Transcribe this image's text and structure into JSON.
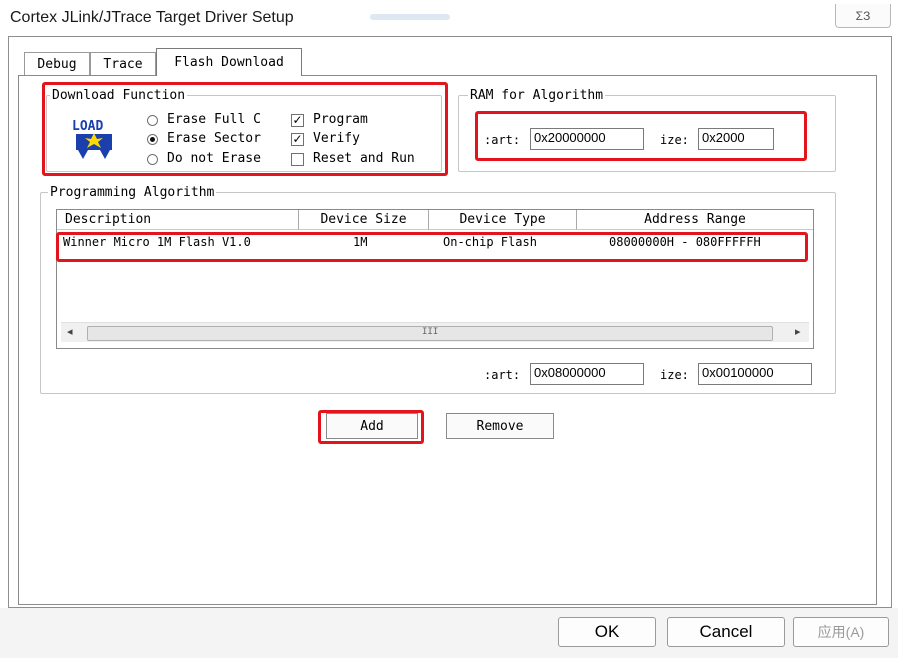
{
  "window": {
    "title": "Cortex JLink/JTrace Target Driver Setup",
    "close_glyph": "ΣЗ"
  },
  "tabs": [
    {
      "label": "Debug"
    },
    {
      "label": "Trace"
    },
    {
      "label": "Flash Download",
      "active": true
    }
  ],
  "download_function": {
    "title": "Download Function",
    "icon_label": "LOAD",
    "radios": [
      {
        "label": "Erase Full C",
        "selected": false
      },
      {
        "label": "Erase Sector",
        "selected": true
      },
      {
        "label": "Do not Erase",
        "selected": false
      }
    ],
    "checks": [
      {
        "label": "Program",
        "checked": true
      },
      {
        "label": "Verify",
        "checked": true
      },
      {
        "label": "Reset and Run",
        "checked": false
      }
    ]
  },
  "ram_algorithm": {
    "title": "RAM for Algorithm",
    "start_label": ":art:",
    "start_value": "0x20000000",
    "size_label": "ize:",
    "size_value": "0x2000"
  },
  "programming_algorithm": {
    "title": "Programming Algorithm",
    "columns": [
      "Description",
      "Device Size",
      "Device Type",
      "Address Range"
    ],
    "rows": [
      {
        "description": "Winner Micro 1M Flash V1.0",
        "device_size": "1M",
        "device_type": "On-chip Flash",
        "address_range": "08000000H - 080FFFFFH"
      }
    ],
    "scroll_grip": "III",
    "start_label": ":art:",
    "start_value": "0x08000000",
    "size_label": "ize:",
    "size_value": "0x00100000"
  },
  "buttons": {
    "add": "Add",
    "remove": "Remove",
    "ok": "OK",
    "cancel": "Cancel",
    "apply": "应用(A)"
  },
  "colors": {
    "highlight": "#e3141b",
    "load_icon_blue": "#1c3fae",
    "load_icon_yellow": "#ffd800"
  }
}
